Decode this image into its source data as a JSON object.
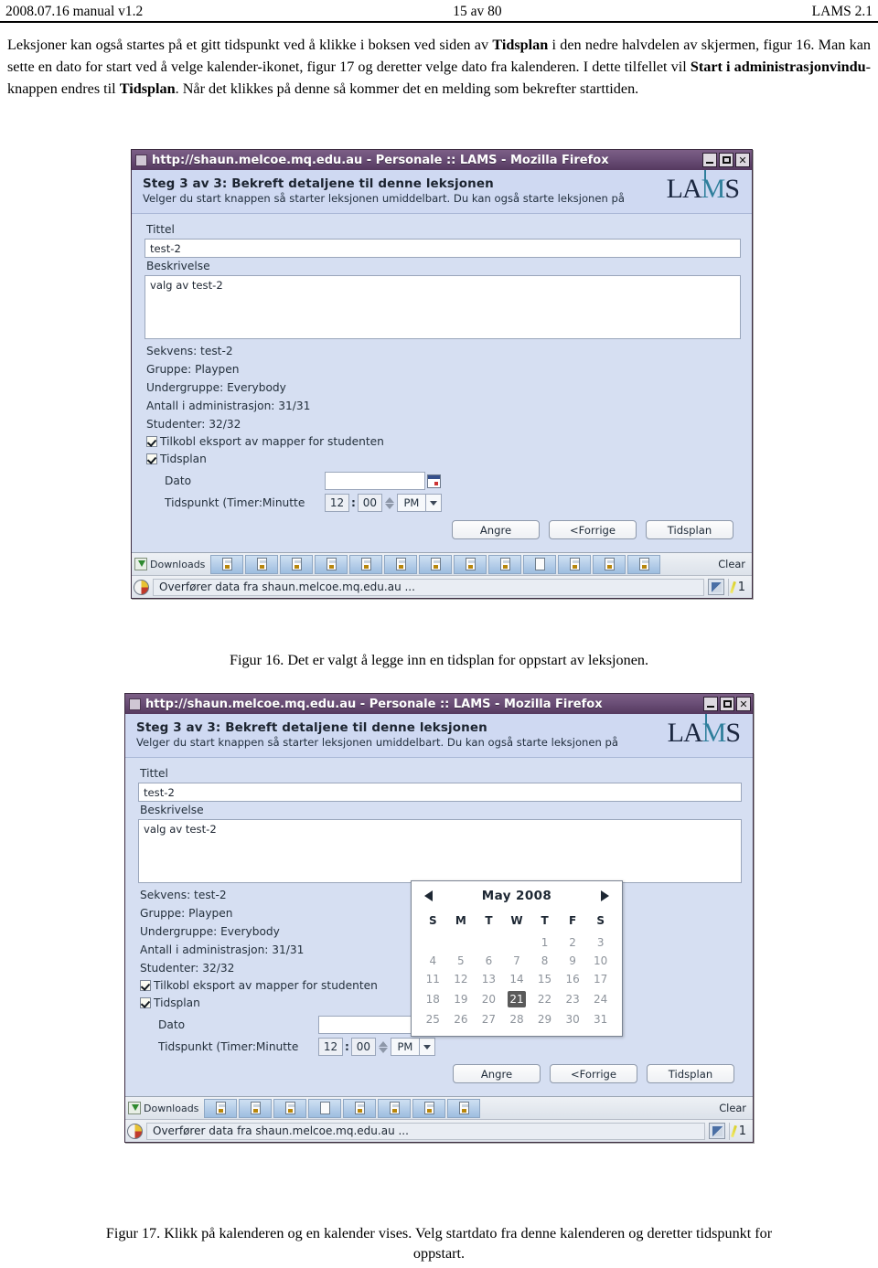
{
  "page_header": {
    "left": "2008.07.16 manual v1.2",
    "center": "15  av 80",
    "right": "LAMS 2.1"
  },
  "body_paragraph": {
    "part1": "Leksjoner kan også startes på et gitt tidspunkt ved å klikke i boksen ved siden av ",
    "bold1": "Tidsplan",
    "part2": " i den nedre halvdelen av skjermen, figur 16. Man kan sette en dato for start ved å velge kalender-ikonet, figur 17 og deretter velge dato fra kalenderen. I dette tilfellet vil ",
    "bold2": "Start i administrasjonvindu",
    "part3": "-knappen endres til   ",
    "bold3": "Tidsplan",
    "part4": ". Når det klikkes på  denne så kommer det en melding som bekrefter starttiden."
  },
  "window": {
    "title": "http://shaun.melcoe.mq.edu.au - Personale :: LAMS - Mozilla Firefox",
    "minimize_label": "minimize",
    "maximize_label": "maximize",
    "close_label": "✕",
    "header_step": "Steg 3 av 3: Bekreft detaljene til denne leksjonen",
    "header_sub": "Velger du start knappen så starter leksjonen umiddelbart. Du kan også starte leksjonen på",
    "logo_a": "LA",
    "logo_m": "M",
    "logo_s": "S"
  },
  "form": {
    "tittel_label": "Tittel",
    "tittel_value": "test-2",
    "beskrivelse_label": "Beskrivelse",
    "beskrivelse_value": "valg av test-2",
    "info": [
      "Sekvens: test-2",
      "Gruppe: Playpen",
      "Undergruppe: Everybody",
      "Antall i administrasjon: 31/31",
      "Studenter: 32/32"
    ],
    "checkbox_export": "Tilkobl eksport av mapper for studenten",
    "checkbox_tidsplan": "Tidsplan",
    "dato_label": "Dato",
    "dato_value": "",
    "tid_label": "Tidspunkt (Timer:Minutte",
    "hour": "12",
    "colon": ":",
    "minute": "00",
    "ampm": "PM",
    "buttons": [
      "Angre",
      "<Forrige",
      "Tidsplan"
    ]
  },
  "downloads": {
    "label": "Downloads",
    "clear": "Clear",
    "item_count_fig16": 13,
    "blank_index_fig16": 9,
    "item_count_fig17": 8,
    "blank_index_fig17": 3
  },
  "status": {
    "text": "Overfører data fra shaun.melcoe.mq.edu.au ...",
    "count": "1"
  },
  "calendar": {
    "month_label": "May 2008",
    "prev_label": "previous month",
    "next_label": "next month",
    "weekdays": [
      "S",
      "M",
      "T",
      "W",
      "T",
      "F",
      "S"
    ],
    "weeks": [
      [
        "",
        "",
        "",
        "",
        "1",
        "2",
        "3"
      ],
      [
        "4",
        "5",
        "6",
        "7",
        "8",
        "9",
        "10"
      ],
      [
        "11",
        "12",
        "13",
        "14",
        "15",
        "16",
        "17"
      ],
      [
        "18",
        "19",
        "20",
        "21",
        "22",
        "23",
        "24"
      ],
      [
        "25",
        "26",
        "27",
        "28",
        "29",
        "30",
        "31"
      ]
    ],
    "selected": "21",
    "selected_color": "#5a5a5a"
  },
  "captions": {
    "fig16": "Figur 16. Det er valgt å legge inn en tidsplan for oppstart av leksjonen.",
    "fig17_line1": "Figur 17. Klikk på kalenderen og en kalender vises. Velg startdato fra denne kalenderen og deretter tidspunkt for",
    "fig17_line2": "oppstart."
  }
}
